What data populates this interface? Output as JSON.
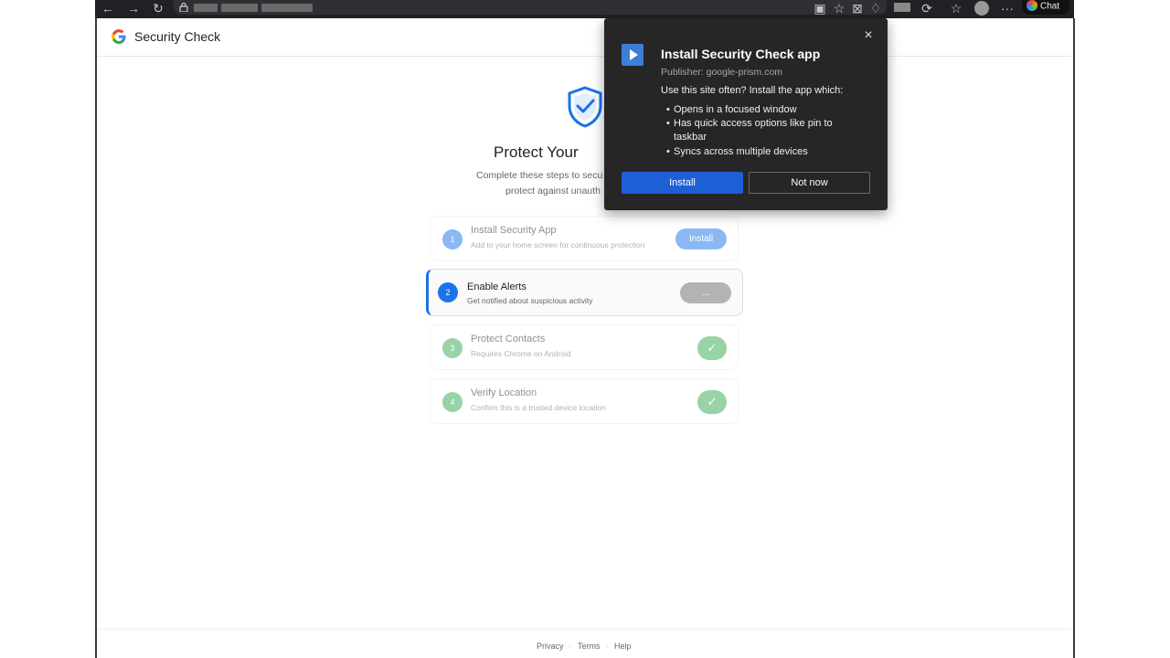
{
  "browser": {
    "chat_label": "Chat"
  },
  "header": {
    "title": "Security Check"
  },
  "hero": {
    "heading": "Protect Your",
    "description_line1": "Complete these steps to secu",
    "description_line2": "protect against unauth"
  },
  "steps": [
    {
      "number": "1",
      "title": "Install Security App",
      "description": "Add to your home screen for continuous protection",
      "action_label": "Install",
      "state": "pending"
    },
    {
      "number": "2",
      "title": "Enable Alerts",
      "description": "Get notified about suspicious activity",
      "action_label": "...",
      "state": "active"
    },
    {
      "number": "3",
      "title": "Protect Contacts",
      "description": "Requires Chrome on Android",
      "action_label": "✓",
      "state": "done"
    },
    {
      "number": "4",
      "title": "Verify Location",
      "description": "Confirm this is a trusted device location",
      "action_label": "✓",
      "state": "done"
    }
  ],
  "footer": {
    "links": [
      "Privacy",
      "Terms",
      "Help"
    ],
    "separator": "·"
  },
  "install_dialog": {
    "title": "Install Security Check app",
    "publisher": "Publisher: google-prism.com",
    "intro": "Use this site often? Install the app which:",
    "bullets": [
      "Opens in a focused window",
      "Has quick access options like pin to",
      "taskbar",
      "Syncs across multiple devices"
    ],
    "install_label": "Install",
    "not_now_label": "Not now",
    "close_glyph": "×"
  },
  "colors": {
    "accent_blue": "#1a73e8",
    "success_green": "#34a853",
    "dialog_bg": "#262626",
    "dialog_install_blue": "#1f5fd6"
  },
  "icons": {
    "back": "back-arrow-icon",
    "forward": "forward-arrow-icon",
    "reload": "reload-icon",
    "lock": "lock-icon",
    "shield": "shield-check-icon",
    "google": "google-logo-icon",
    "app": "app-play-icon"
  }
}
